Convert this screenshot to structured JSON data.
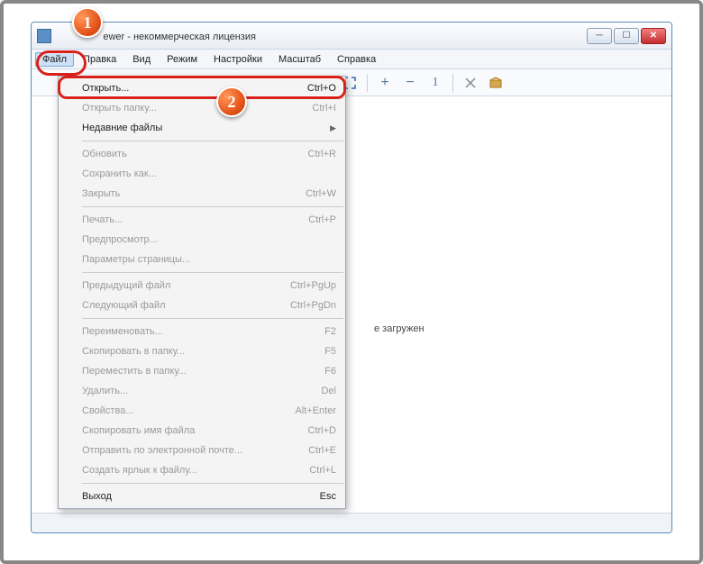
{
  "titlebar": {
    "title_partial": "ewer - некоммерческая лицензия"
  },
  "menubar": {
    "items": [
      "Файл",
      "Правка",
      "Вид",
      "Режим",
      "Настройки",
      "Масштаб",
      "Справка"
    ]
  },
  "dropdown": {
    "items": [
      {
        "label": "Открыть...",
        "shortcut": "Ctrl+O",
        "enabled": true,
        "highlighted": true
      },
      {
        "label": "Открыть папку...",
        "shortcut": "Ctrl+I",
        "enabled": false
      },
      {
        "label": "Недавние файлы",
        "submenu": true,
        "enabled": true
      },
      {
        "sep": true
      },
      {
        "label": "Обновить",
        "shortcut": "Ctrl+R",
        "enabled": false
      },
      {
        "label": "Сохранить как...",
        "shortcut": "",
        "enabled": false
      },
      {
        "label": "Закрыть",
        "shortcut": "Ctrl+W",
        "enabled": false
      },
      {
        "sep": true
      },
      {
        "label": "Печать...",
        "shortcut": "Ctrl+P",
        "enabled": false
      },
      {
        "label": "Предпросмотр...",
        "shortcut": "",
        "enabled": false
      },
      {
        "label": "Параметры страницы...",
        "shortcut": "",
        "enabled": false
      },
      {
        "sep": true
      },
      {
        "label": "Предыдущий файл",
        "shortcut": "Ctrl+PgUp",
        "enabled": false
      },
      {
        "label": "Следующий файл",
        "shortcut": "Ctrl+PgDn",
        "enabled": false
      },
      {
        "sep": true
      },
      {
        "label": "Переименовать...",
        "shortcut": "F2",
        "enabled": false
      },
      {
        "label": "Скопировать в папку...",
        "shortcut": "F5",
        "enabled": false
      },
      {
        "label": "Переместить в папку...",
        "shortcut": "F6",
        "enabled": false
      },
      {
        "label": "Удалить...",
        "shortcut": "Del",
        "enabled": false
      },
      {
        "label": "Свойства...",
        "shortcut": "Alt+Enter",
        "enabled": false
      },
      {
        "label": "Скопировать имя файла",
        "shortcut": "Ctrl+D",
        "enabled": false
      },
      {
        "label": "Отправить по электронной почте...",
        "shortcut": "Ctrl+E",
        "enabled": false
      },
      {
        "label": "Создать ярлык к файлу...",
        "shortcut": "Ctrl+L",
        "enabled": false
      },
      {
        "sep": true
      },
      {
        "label": "Выход",
        "shortcut": "Esc",
        "enabled": true
      }
    ]
  },
  "content": {
    "message_partial": "е загружен"
  },
  "badges": {
    "one": "1",
    "two": "2"
  },
  "icons": {
    "fullscreen": "⛶",
    "plus": "+",
    "minus": "−",
    "one": "1",
    "tools": "✖",
    "box": "▭"
  }
}
